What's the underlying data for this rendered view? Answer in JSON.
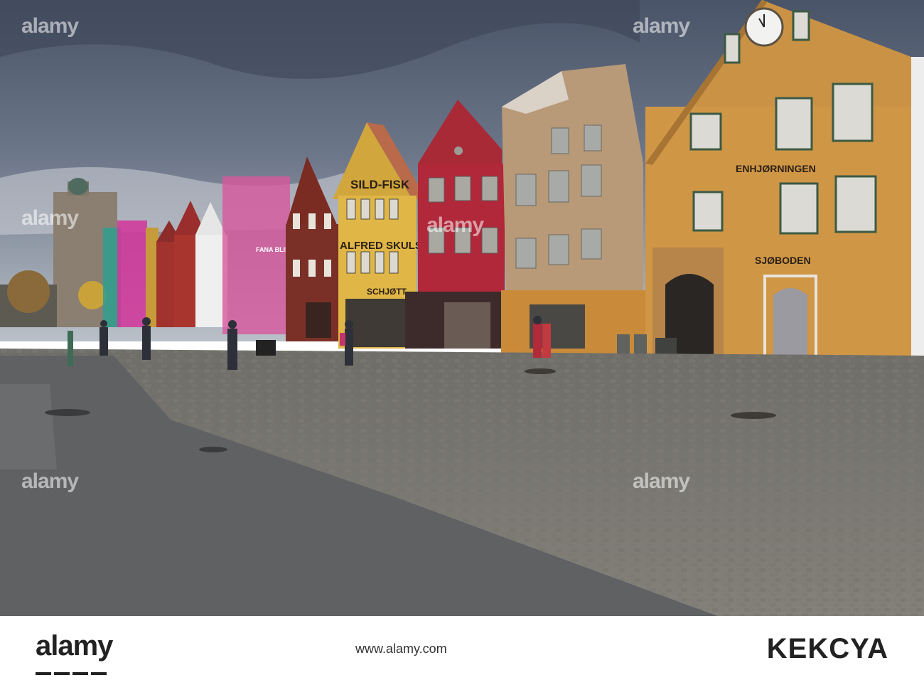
{
  "scene": {
    "sign_sild": "SILD-FISK",
    "sign_alfred": "ALFRED SKULSTAD",
    "sign_schjott": "SCHJØTT",
    "sign_enhjorningen": "ENHJØRNINGEN",
    "sign_sjoboden": "SJØBODEN",
    "sign_fana": "FANA BLIKK"
  },
  "watermark": {
    "text": "alamy"
  },
  "banner": {
    "brand": "alamy",
    "url": "www.alamy.com",
    "image_id": "KEKCYA"
  }
}
